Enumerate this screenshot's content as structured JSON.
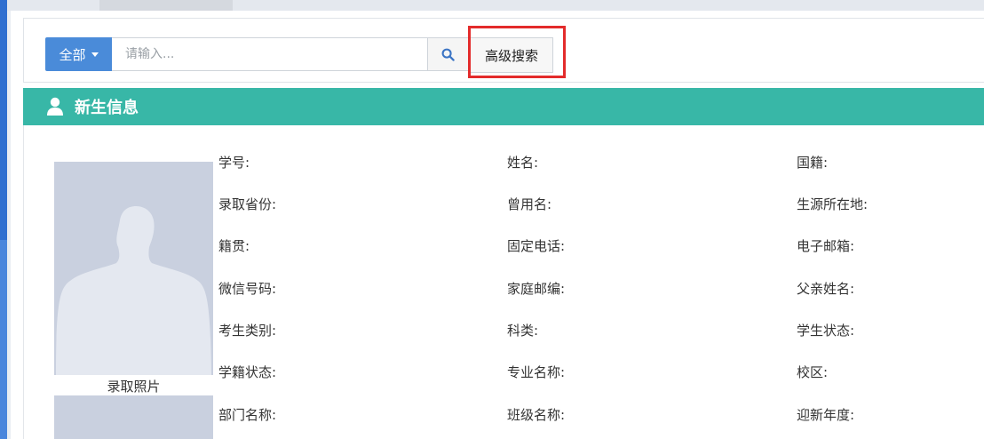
{
  "search": {
    "scope_label": "全部",
    "placeholder": "请输入...",
    "advanced_label": "高级搜索"
  },
  "section": {
    "title": "新生信息"
  },
  "photo": {
    "caption": "录取照片"
  },
  "fields": {
    "col1": [
      "学号:",
      "录取省份:",
      "籍贯:",
      "微信号码:",
      "考生类别:",
      "学籍状态:",
      "部门名称:"
    ],
    "col2": [
      "姓名:",
      "曾用名:",
      "固定电话:",
      "家庭邮编:",
      "科类:",
      "专业名称:",
      "班级名称:"
    ],
    "col3": [
      "国籍:",
      "生源所在地:",
      "电子邮箱:",
      "父亲姓名:",
      "学生状态:",
      "校区:",
      "迎新年度:"
    ]
  },
  "colors": {
    "primary": "#4a8bd9",
    "header": "#38b7a7",
    "highlight": "#e32b2b",
    "photo_bg": "#c9d0df"
  },
  "icons": {
    "scope": "caret-down-icon",
    "search": "search-icon",
    "section": "user-icon"
  }
}
